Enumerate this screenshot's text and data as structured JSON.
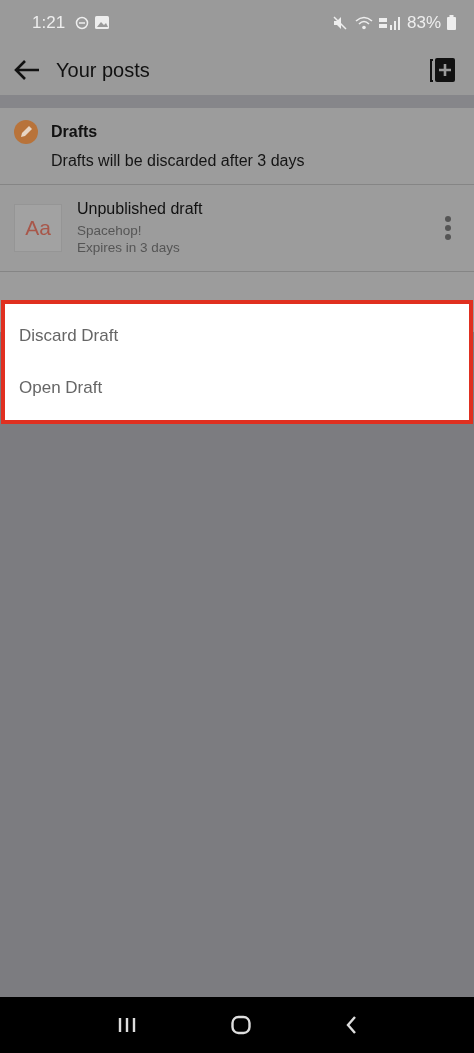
{
  "status_bar": {
    "time": "1:21",
    "battery": "83%"
  },
  "header": {
    "title": "Your posts"
  },
  "drafts_section": {
    "title": "Drafts",
    "note": "Drafts will be discarded after 3 days"
  },
  "drafts": [
    {
      "thumbnail": "Aa",
      "title": "Unpublished draft",
      "subtitle": "Spacehop!",
      "expiry": "Expires in 3 days"
    }
  ],
  "menu": {
    "items": [
      {
        "label": "Discard Draft"
      },
      {
        "label": "Open Draft"
      }
    ]
  }
}
